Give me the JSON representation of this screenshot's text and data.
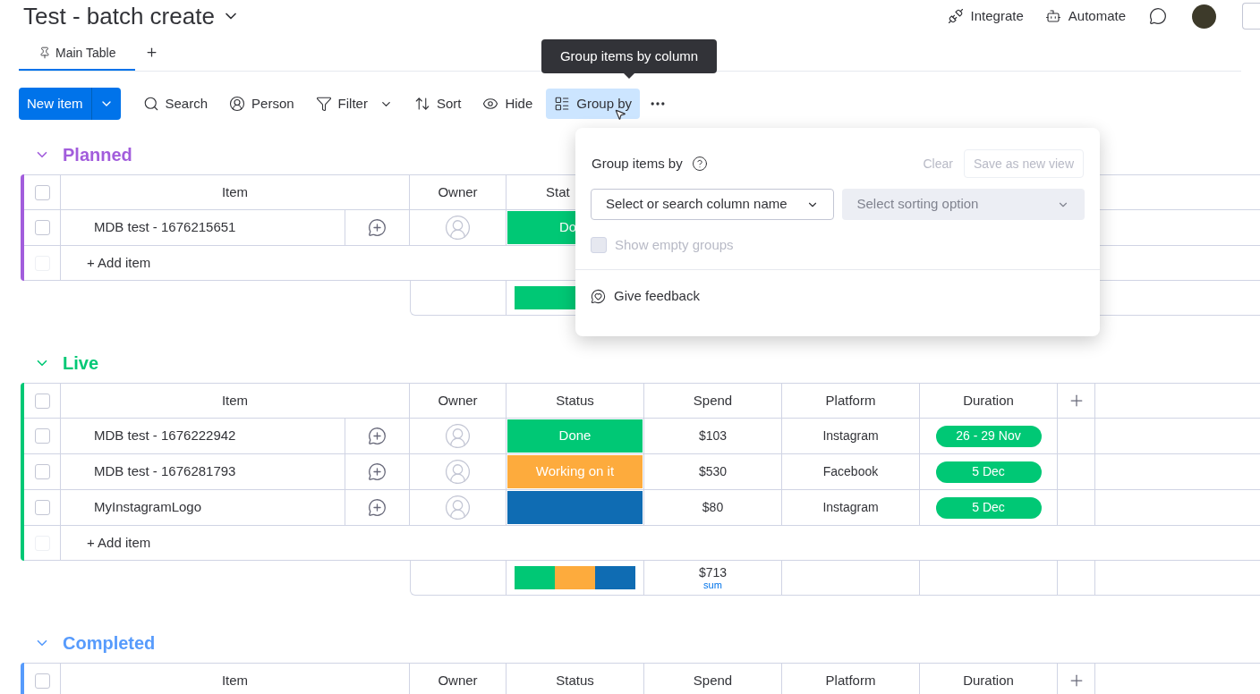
{
  "board": {
    "title": "Test - batch create"
  },
  "top_actions": [
    {
      "label": "Integrate"
    },
    {
      "label": "Automate"
    }
  ],
  "tabs": [
    {
      "label": "Main Table",
      "selected": true
    }
  ],
  "toolbar": {
    "new_item": "New item",
    "buttons": [
      {
        "label": "Search",
        "selected": false,
        "dropdown": false
      },
      {
        "label": "Person",
        "selected": false,
        "dropdown": false
      },
      {
        "label": "Filter",
        "selected": false,
        "dropdown": true
      },
      {
        "label": "Sort",
        "selected": false,
        "dropdown": false
      },
      {
        "label": "Hide",
        "selected": false,
        "dropdown": false
      },
      {
        "label": "Group by",
        "selected": true,
        "dropdown": false
      }
    ]
  },
  "tooltip": "Group items by column",
  "popover": {
    "title": "Group items by",
    "clear": "Clear",
    "save": "Save as new view",
    "column_select": {
      "placeholder": "Select or search column name",
      "disabled": false
    },
    "sort_select": {
      "placeholder": "Select sorting option",
      "disabled": true
    },
    "show_empty": {
      "label": "Show empty groups",
      "checked": false,
      "disabled": true
    },
    "feedback": "Give feedback"
  },
  "groups": [
    {
      "name": "Planned",
      "color": "#a25ddc",
      "all_checked": false,
      "columns": [
        "Item",
        "Owner",
        "Stat"
      ],
      "rows": [
        {
          "item": "MDB test - 1676215651",
          "checked": false,
          "status": {
            "label": "Do",
            "color": "#00c875"
          }
        }
      ],
      "add_item": "+ Add item"
    },
    {
      "name": "Live",
      "color": "#00c875",
      "all_checked": false,
      "columns": [
        "Item",
        "Owner",
        "Status",
        "Spend",
        "Platform",
        "Duration"
      ],
      "rows": [
        {
          "item": "MDB test - 1676222942",
          "checked": false,
          "status": {
            "label": "Done",
            "color": "#00c875"
          },
          "spend": "$103",
          "platform": "Instagram",
          "duration": "26 - 29 Nov"
        },
        {
          "item": "MDB test - 1676281793",
          "checked": false,
          "status": {
            "label": "Working on it",
            "color": "#fdab3d"
          },
          "spend": "$530",
          "platform": "Facebook",
          "duration": "5 Dec"
        },
        {
          "item": "MyInstagramLogo",
          "checked": false,
          "status": {
            "color": "#0f6cb3"
          },
          "spend": "$80",
          "platform": "Instagram",
          "duration": "5 Dec"
        }
      ],
      "add_item": "+ Add item",
      "summary": {
        "spend": "$713",
        "spend_label": "sum"
      }
    },
    {
      "name": "Completed",
      "color": "#579bfc",
      "all_checked": false,
      "columns": [
        "Item",
        "Owner",
        "Status",
        "Spend",
        "Platform",
        "Duration"
      ]
    }
  ]
}
